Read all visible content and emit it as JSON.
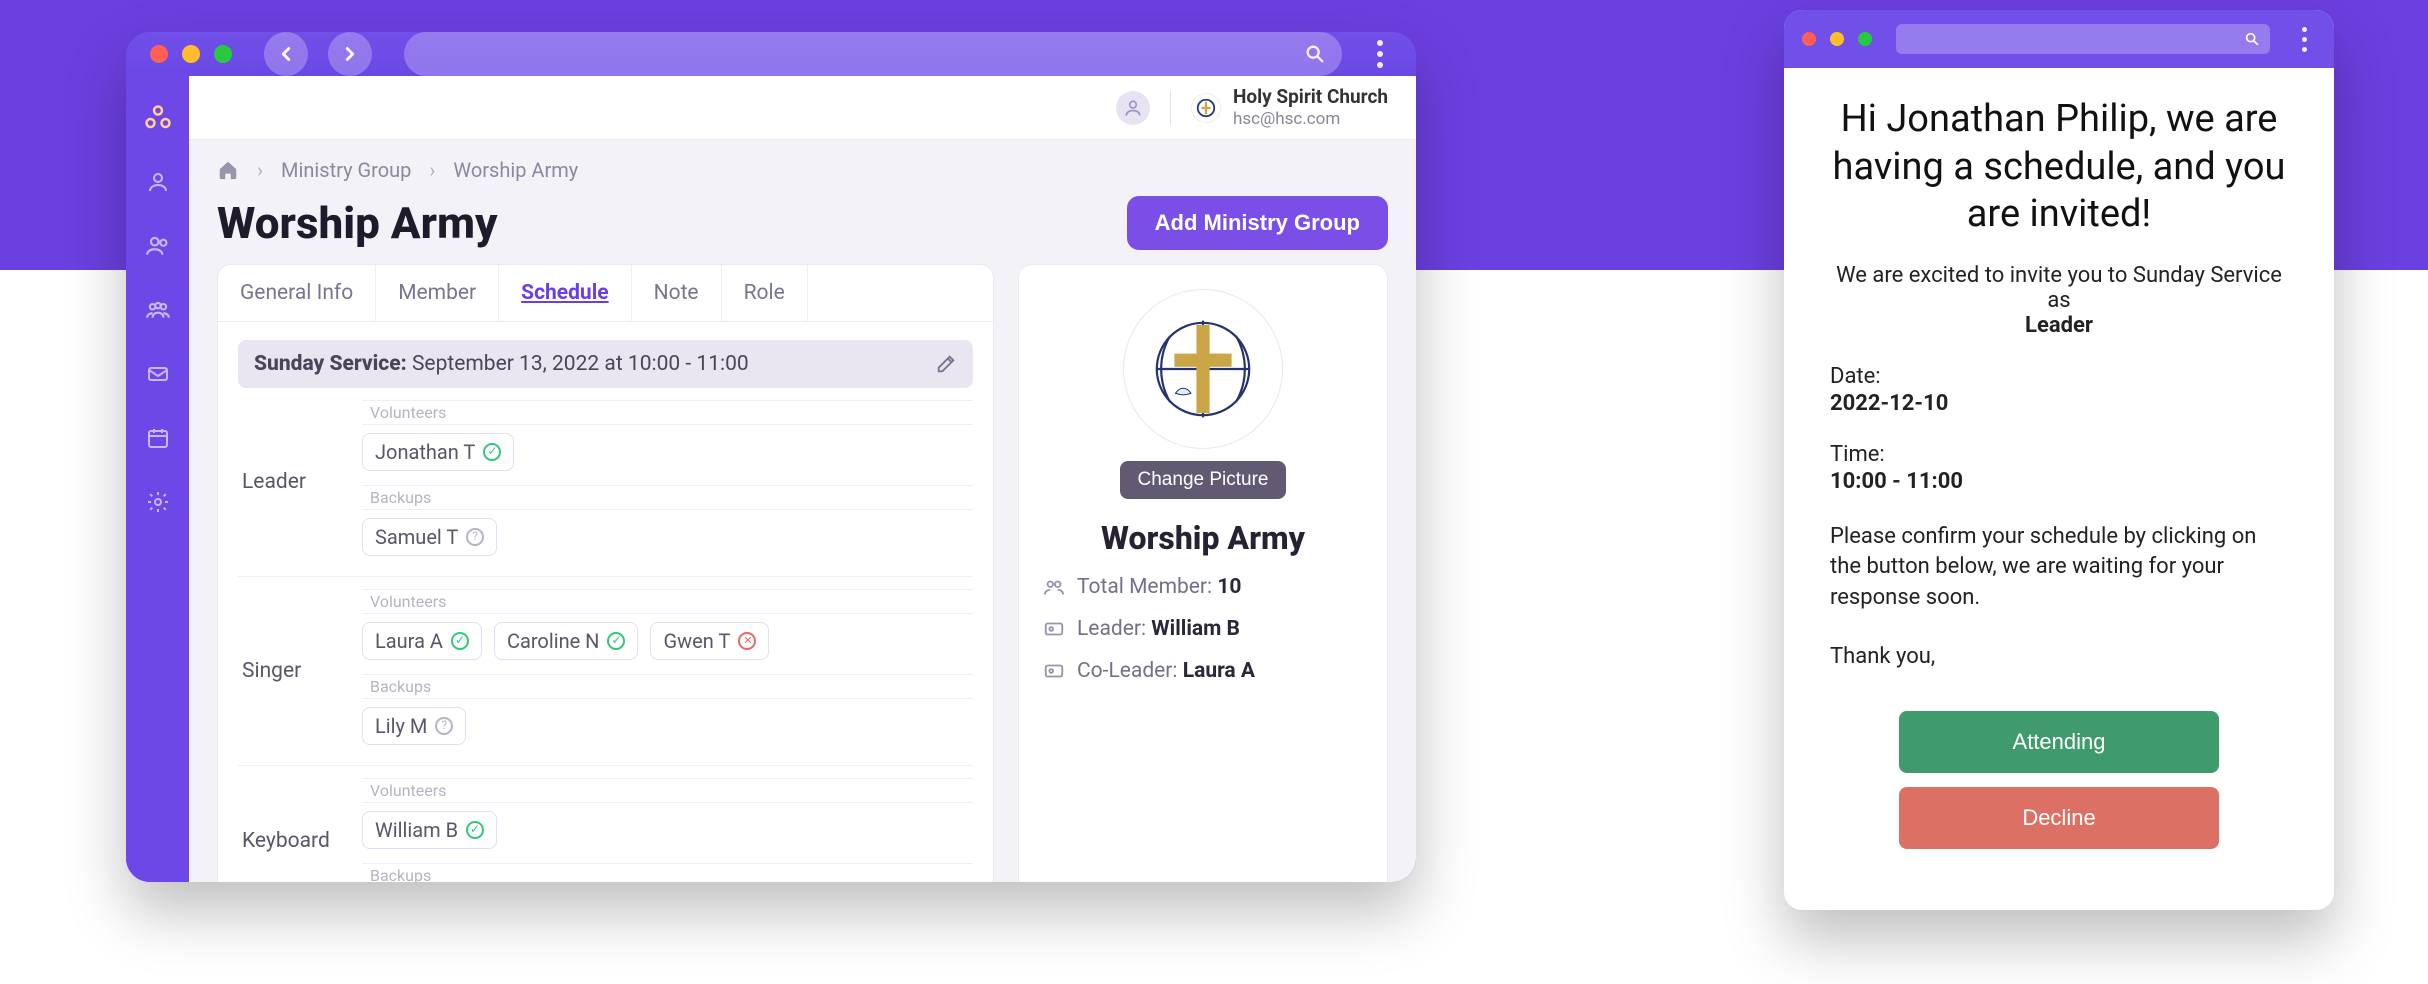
{
  "app": {
    "breadcrumb": {
      "group": "Ministry Group",
      "current": "Worship Army"
    },
    "title": "Worship Army",
    "add_button": "Add Ministry Group",
    "header": {
      "church_name": "Holy Spirit Church",
      "church_email": "hsc@hsc.com"
    },
    "tabs": [
      "General Info",
      "Member",
      "Schedule",
      "Note",
      "Role"
    ],
    "active_tab_index": 2,
    "schedule": {
      "service_label": "Sunday Service:",
      "service_detail": " September 13, 2022 at 10:00 - 11:00",
      "volunteers_label": "Volunteers",
      "backups_label": "Backups",
      "roles": [
        {
          "name": "Leader",
          "volunteers": [
            {
              "name": "Jonathan T",
              "status": "ok"
            }
          ],
          "backups": [
            {
              "name": "Samuel T",
              "status": "pending"
            }
          ]
        },
        {
          "name": "Singer",
          "volunteers": [
            {
              "name": "Laura A",
              "status": "ok"
            },
            {
              "name": "Caroline N",
              "status": "ok"
            },
            {
              "name": "Gwen T",
              "status": "no"
            }
          ],
          "backups": [
            {
              "name": "Lily M",
              "status": "pending"
            }
          ]
        },
        {
          "name": "Keyboard",
          "volunteers": [
            {
              "name": "William B",
              "status": "ok"
            }
          ],
          "backups": []
        }
      ]
    },
    "group_panel": {
      "change_picture": "Change Picture",
      "name": "Worship Army",
      "total_label": "Total Member: ",
      "total_value": "10",
      "leader_label": "Leader: ",
      "leader_value": "William B",
      "coleader_label": "Co-Leader: ",
      "coleader_value": "Laura A"
    }
  },
  "email": {
    "title": "Hi Jonathan Philip, we are having a schedule, and you are invited!",
    "intro_1": "We are excited to invite you to Sunday Service as ",
    "intro_role": "Leader",
    "date_label": "Date:",
    "date_value": "2022-12-10",
    "time_label": "Time:",
    "time_value": "10:00 - 11:00",
    "confirm": "Please confirm your schedule by clicking on the button below, we are waiting for your response soon.",
    "thanks": "Thank you,",
    "attend": "Attending",
    "decline": "Decline"
  }
}
